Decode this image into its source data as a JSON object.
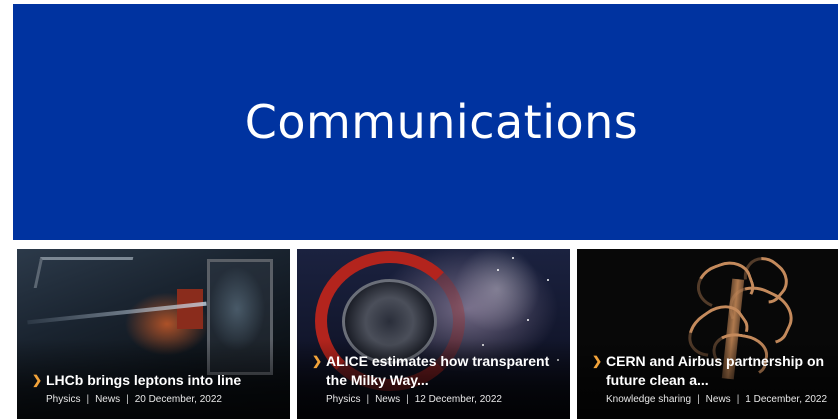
{
  "hero": {
    "title": "Communications",
    "background_color": "#0033a0"
  },
  "cards": [
    {
      "title": "LHCb brings leptons into line",
      "category": "Physics",
      "type": "News",
      "date": "20 December, 2022"
    },
    {
      "title": "ALICE estimates how transparent the Milky Way...",
      "category": "Physics",
      "type": "News",
      "date": "12 December, 2022"
    },
    {
      "title": "CERN and Airbus partnership on future clean a...",
      "category": "Knowledge sharing",
      "type": "News",
      "date": "1 December, 2022"
    }
  ],
  "meta_separator": "|",
  "accent_color": "#f2a33a",
  "icons": {
    "card_chevron": "chevron-right-icon"
  }
}
